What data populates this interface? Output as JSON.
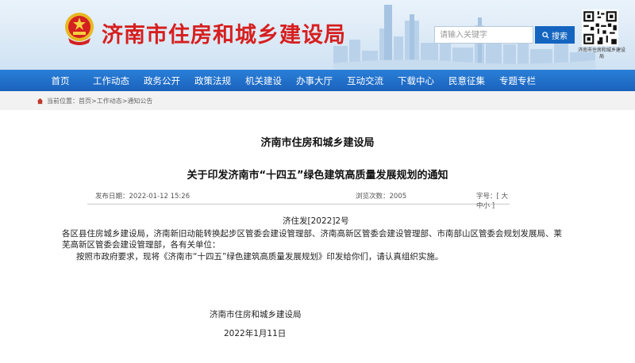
{
  "header": {
    "site_title": "济南市住房和城乡建设局",
    "search_placeholder": "请输入关键字",
    "search_button": "搜索",
    "qr_caption": "济南市住房和城乡建设局"
  },
  "nav": {
    "items": [
      "首页",
      "工作动态",
      "政务公开",
      "政策法规",
      "机关建设",
      "办事大厅",
      "互动交流",
      "下载中心",
      "民意征集",
      "专题专栏"
    ]
  },
  "breadcrumb": {
    "current_label": "当前位置：",
    "items": [
      "首页",
      "工作动态",
      "通知公告"
    ],
    "separator": " > "
  },
  "article": {
    "org_name": "济南市住房和城乡建设局",
    "title": "关于印发济南市“十四五”绿色建筑高质量发展规划的通知",
    "publish_label": "发布日期：",
    "publish_date": "2022-01-12 15:26",
    "views_label": "浏览次数：",
    "views": "2005",
    "font_label": "字号：",
    "font_open": "[ ",
    "font_large": "大",
    "font_medium": "中",
    "font_small": "小",
    "font_close": " ]",
    "doc_number": "济住发[2022]2号",
    "addressees": "各区县住房城乡建设局，济南新旧动能转换起步区管委会建设管理部、济南高新区管委会建设管理部、市南部山区管委会规划发展局、莱芜高新区管委会建设管理部，各有关单位：",
    "paragraph": "按照市政府要求，现将《济南市“十四五”绿色建筑高质量发展规划》印发给你们，请认真组织实施。",
    "sign_org": "济南市住房和城乡建设局",
    "sign_date": "2022年1月11日"
  },
  "colors": {
    "title_red": "#d61f1f",
    "nav_blue": "#1a62bc",
    "search_blue": "#1565c0"
  }
}
